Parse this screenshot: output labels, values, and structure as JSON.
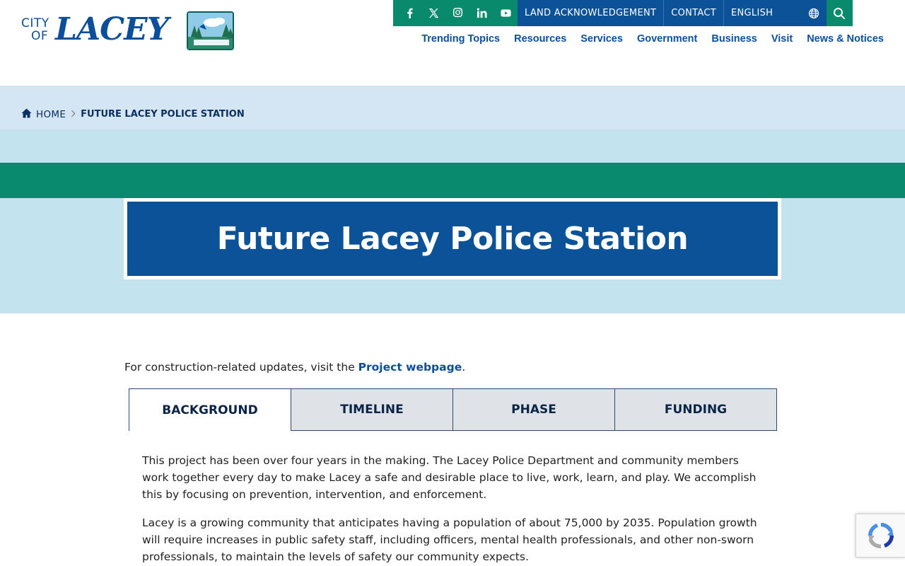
{
  "header": {
    "logo": {
      "line1": "CITY",
      "line2": "OF",
      "name": "LACEY"
    },
    "social": [
      "facebook-icon",
      "x-twitter-icon",
      "instagram-icon",
      "linkedin-icon",
      "youtube-icon"
    ],
    "utility": {
      "land": "LAND ACKNOWLEDGEMENT",
      "contact": "CONTACT",
      "language": "ENGLISH"
    },
    "nav": [
      "Trending Topics",
      "Resources",
      "Services",
      "Government",
      "Business",
      "Visit",
      "News & Notices"
    ]
  },
  "breadcrumb": {
    "home": "HOME",
    "current": "FUTURE LACEY POLICE STATION"
  },
  "hero": {
    "title": "Future Lacey Police Station"
  },
  "content": {
    "intro_prefix": "For construction-related updates, visit the ",
    "intro_link": "Project webpage",
    "intro_suffix": ".",
    "tabs": [
      "BACKGROUND",
      "TIMELINE",
      "PHASE",
      "FUNDING"
    ],
    "active_tab": "BACKGROUND",
    "paragraphs": [
      "This project has been over four years in the making. The Lacey Police Department and community members work together every day to make Lacey a safe and desirable place to live, work, learn, and play. We accomplish this by focusing on prevention, intervention, and enforcement.",
      "Lacey is a growing community that anticipates having a population of about 75,000 by 2035. Population growth will require increases in public safety staff, including officers, mental health professionals, and other non-sworn professionals, to maintain the levels of safety our community expects."
    ]
  },
  "colors": {
    "brand_blue": "#0b5299",
    "brand_green": "#0a8a6c",
    "hero_light": "#c3e3ef",
    "crumb_band": "#d4e6f4"
  }
}
